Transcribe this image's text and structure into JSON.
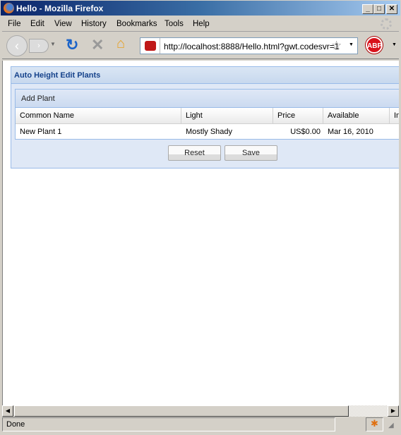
{
  "window": {
    "title": "Hello - Mozilla Firefox",
    "minimize": "_",
    "maximize": "□",
    "close": "✕"
  },
  "menu": [
    "File",
    "Edit",
    "View",
    "History",
    "Bookmarks",
    "Tools",
    "Help"
  ],
  "nav": {
    "url": "http://localhost:8888/Hello.html?gwt.codesvr=1",
    "abp": "ABP"
  },
  "panel": {
    "title": "Auto Height Edit Plants",
    "add_label": "Add Plant",
    "columns": [
      "Common Name",
      "Light",
      "Price",
      "Available",
      "In"
    ],
    "rows": [
      [
        "New Plant 1",
        "Mostly Shady",
        "US$0.00",
        "Mar 16, 2010",
        ""
      ]
    ],
    "reset": "Reset",
    "save": "Save"
  },
  "status": {
    "text": "Done"
  }
}
